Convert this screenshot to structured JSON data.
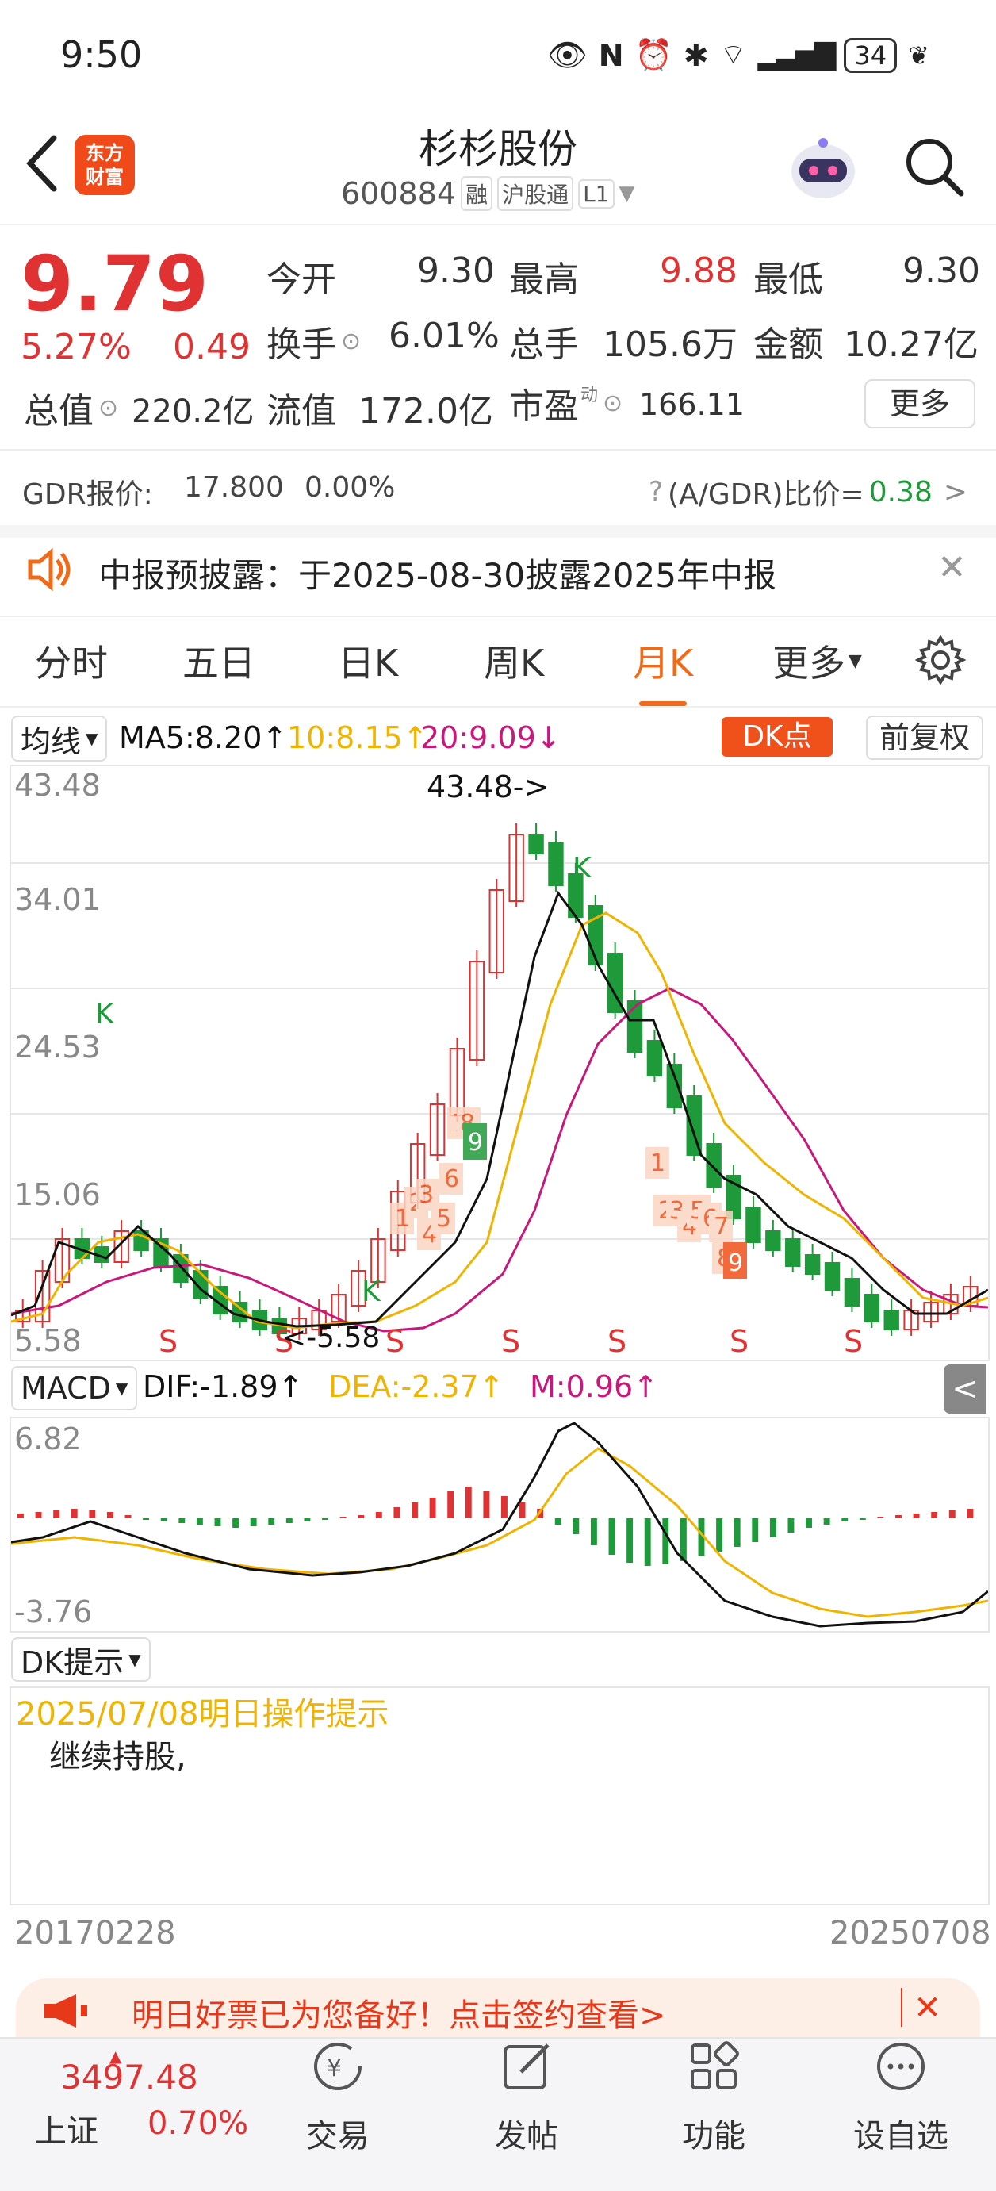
{
  "status_bar": {
    "time": "9:50",
    "battery": "34"
  },
  "header": {
    "back": "<",
    "logo": "东方\n财富",
    "title": "杉杉股份",
    "code": "600884",
    "tags": [
      "融",
      "沪股通",
      "L1"
    ]
  },
  "quote": {
    "price": "9.79",
    "change_pct": "5.27%",
    "change": "0.49",
    "items": [
      {
        "label": "今开",
        "value": "9.30"
      },
      {
        "label": "最高",
        "value": "9.88"
      },
      {
        "label": "最低",
        "value": "9.30"
      },
      {
        "label": "换手",
        "value": "6.01%"
      },
      {
        "label": "总手",
        "value": "105.6万"
      },
      {
        "label": "金额",
        "value": "10.27亿"
      },
      {
        "label": "总值",
        "value": "220.2亿"
      },
      {
        "label": "流值",
        "value": "172.0亿"
      },
      {
        "label": "市盈",
        "value": "166.11"
      }
    ],
    "pe_superscript": "动",
    "more_button": "更多"
  },
  "gdr": {
    "label": "GDR报价:",
    "price": "17.800",
    "pct": "0.00%",
    "ratio_label": "(A/GDR)比价=",
    "ratio_value": "0.38",
    "arrow": ">"
  },
  "notice": {
    "text": "中报预披露：于2025-08-30披露2025年中报",
    "close": "✕"
  },
  "tabs": [
    "分时",
    "五日",
    "日K",
    "周K",
    "月K",
    "更多"
  ],
  "active_tab": 4,
  "ma_bar": {
    "selector": "均线",
    "ma5": "MA5:8.20↑",
    "ma10": "10:8.15↑",
    "ma20": "20:9.09↓",
    "dk_button": "DK点",
    "adjust_button": "前复权"
  },
  "chart_data": {
    "type": "candlestick",
    "y_labels": [
      "43.48",
      "34.01",
      "24.53",
      "15.06",
      "5.58"
    ],
    "annotation_high": "43.48->",
    "annotation_low": "<-5.58",
    "signals": [
      "K",
      "K",
      "K",
      "S",
      "S",
      "S",
      "S",
      "S",
      "S",
      "S"
    ],
    "colors": {
      "up": "#e03232",
      "down": "#1f9a3a",
      "ma5": "#000000",
      "ma10": "#f0b400",
      "ma20": "#c8187c"
    }
  },
  "macd": {
    "selector": "MACD",
    "dif": "DIF:-1.89↑",
    "dea": "DEA:-2.37↑",
    "m": "M:0.96↑",
    "y_top": "6.82",
    "y_bottom": "-3.76"
  },
  "dk": {
    "selector": "DK提示",
    "date_line": "2025/07/08明日操作提示",
    "advice": "继续持股,"
  },
  "date_range": {
    "start": "20170228",
    "end": "20250708"
  },
  "promo": {
    "text": "明日好票已为您备好！点击签约查看>",
    "close": "✕"
  },
  "bottom_bar": {
    "index_value": "3497.48",
    "index_name": "上证",
    "index_pct": "0.70%",
    "items": [
      "交易",
      "发帖",
      "功能",
      "设自选"
    ]
  }
}
